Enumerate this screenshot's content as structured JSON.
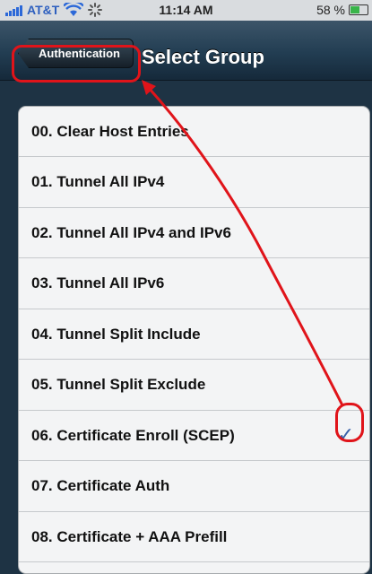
{
  "status_bar": {
    "carrier": "AT&T",
    "time": "11:14 AM",
    "battery": "58 %",
    "battery_level": 0.58,
    "signal_icon": "signal-bars-icon",
    "wifi_icon": "wifi-icon",
    "activity_icon": "activity-spinner-icon"
  },
  "navbar": {
    "back_label": "Authentication",
    "title": "Select Group"
  },
  "groups": [
    "00. Clear Host Entries",
    "01. Tunnel All IPv4",
    "02. Tunnel All IPv4 and IPv6",
    "03. Tunnel All IPv6",
    "04. Tunnel Split Include",
    "05. Tunnel Split Exclude",
    "06. Certificate Enroll (SCEP)",
    "07. Certificate Auth",
    "08. Certificate + AAA Prefill"
  ],
  "selected_index": 6,
  "checkmark": "✓",
  "colors": {
    "annotation": "#e0141a",
    "checkmark": "#3860a8",
    "navbar": "#223d52"
  }
}
